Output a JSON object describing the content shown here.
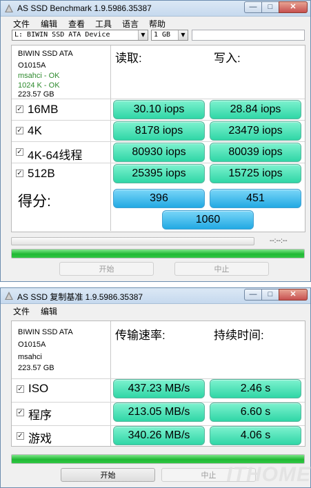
{
  "window1": {
    "title": "AS SSD Benchmark 1.9.5986.35387",
    "menu": [
      "文件",
      "编辑",
      "查看",
      "工具",
      "语言",
      "帮助"
    ],
    "drive_select": "L: BIWIN SSD ATA Device",
    "size_select": "1 GB",
    "info": {
      "model": "BIWIN SSD ATA",
      "firmware": "O1015A",
      "driver": "msahci - OK",
      "alignment": "1024 K - OK",
      "capacity": "223.57 GB"
    },
    "read_header": "读取:",
    "write_header": "写入:",
    "tests": [
      {
        "label": "16MB",
        "read": "30.10 iops",
        "write": "28.84 iops"
      },
      {
        "label": "4K",
        "read": "8178 iops",
        "write": "23479 iops"
      },
      {
        "label": "4K-64线程",
        "read": "80930 iops",
        "write": "80039 iops"
      },
      {
        "label": "512B",
        "read": "25395 iops",
        "write": "15725 iops"
      }
    ],
    "score_label": "得分:",
    "score_read": "396",
    "score_write": "451",
    "score_total": "1060",
    "timer": "--:--:--",
    "progress_top": 0,
    "progress_bottom": 1.0,
    "start_button": "开始",
    "abort_button": "中止"
  },
  "window2": {
    "title": "AS SSD 复制基准 1.9.5986.35387",
    "menu": [
      "文件",
      "编辑"
    ],
    "info": {
      "model": "BIWIN SSD ATA",
      "firmware": "O1015A",
      "driver": "msahci",
      "capacity": "223.57 GB"
    },
    "rate_header": "传输速率:",
    "time_header": "持续时间:",
    "tests": [
      {
        "label": "ISO",
        "rate": "437.23 MB/s",
        "time": "2.46 s"
      },
      {
        "label": "程序",
        "rate": "213.05 MB/s",
        "time": "6.60 s"
      },
      {
        "label": "游戏",
        "rate": "340.26 MB/s",
        "time": "4.06 s"
      }
    ],
    "progress": 1.0,
    "start_button": "开始",
    "abort_button": "中止"
  },
  "watermark": "ITHOME",
  "colors": {
    "result_green": "#2fd6a6",
    "score_blue": "#22a9e3",
    "progress_green": "#20b934",
    "ok_green": "#2d8a2d"
  }
}
